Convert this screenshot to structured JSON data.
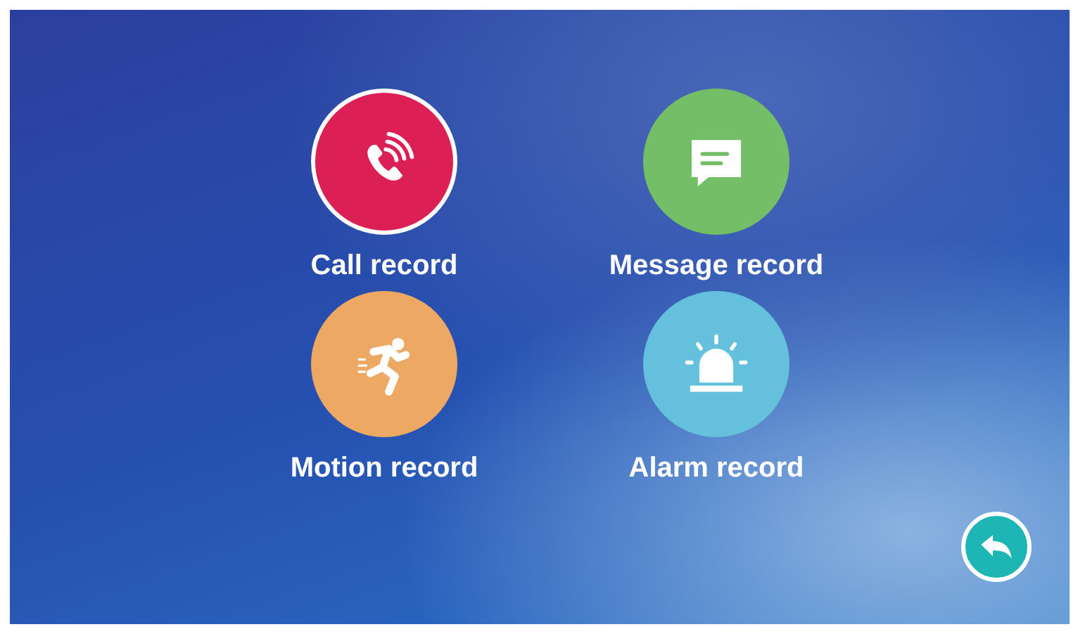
{
  "menu": [
    {
      "kind": "call",
      "label": "Call record",
      "color": "#dc1f55",
      "selected": true
    },
    {
      "kind": "message",
      "label": "Message record",
      "color": "#74be67",
      "selected": false
    },
    {
      "kind": "motion",
      "label": "Motion record",
      "color": "#eda863",
      "selected": false
    },
    {
      "kind": "alarm",
      "label": "Alarm record",
      "color": "#64c0dc",
      "selected": false
    }
  ],
  "back_button": {
    "kind": "back"
  }
}
